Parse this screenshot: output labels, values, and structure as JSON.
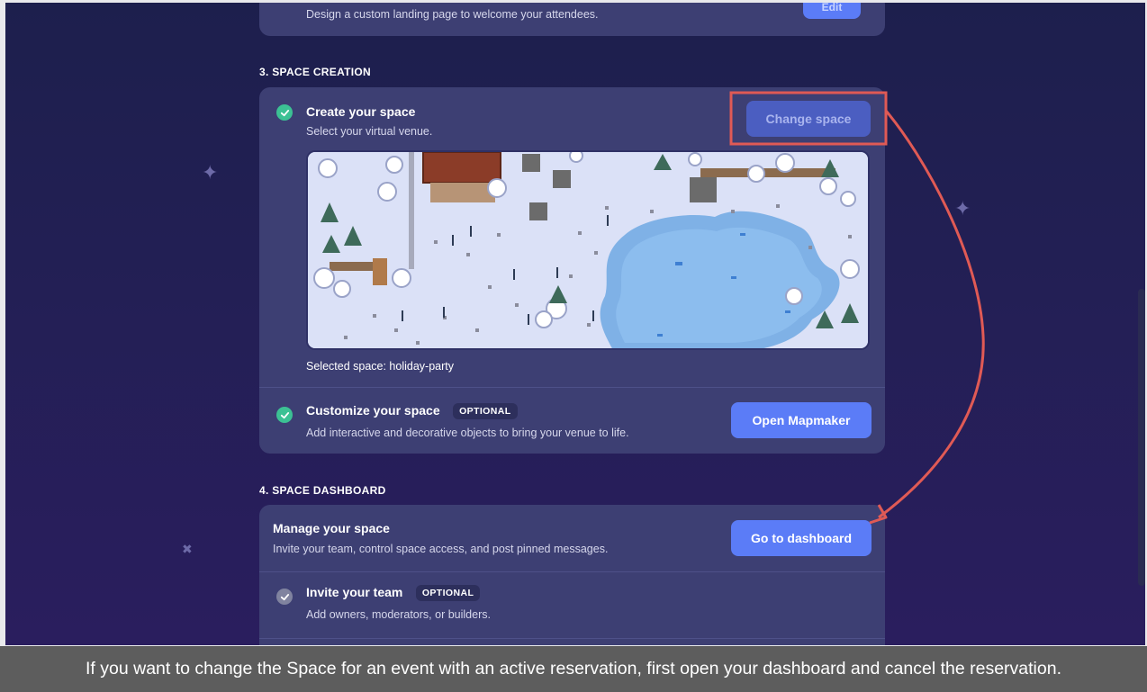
{
  "landing": {
    "description": "Design a custom landing page to welcome your attendees.",
    "button_label": "Edit"
  },
  "space_creation": {
    "heading": "3. SPACE CREATION",
    "create": {
      "title": "Create your space",
      "description": "Select your virtual venue.",
      "button_label": "Change space",
      "selected": "Selected space: holiday-party"
    },
    "customize": {
      "title": "Customize your space",
      "badge": "OPTIONAL",
      "description": "Add interactive and decorative objects to bring your venue to life.",
      "button_label": "Open Mapmaker"
    }
  },
  "space_dashboard": {
    "heading": "4. SPACE DASHBOARD",
    "manage": {
      "title": "Manage your space",
      "description": "Invite your team, control space access, and post pinned messages.",
      "button_label": "Go to dashboard"
    },
    "invite": {
      "title": "Invite your team",
      "badge": "OPTIONAL",
      "description": "Add owners, moderators, or builders."
    }
  },
  "caption": "If you want to change the Space for an event with an active reservation, first open your dashboard and cancel the reservation.",
  "colors": {
    "accent": "#5b7cf7",
    "success": "#3cc194",
    "highlight_box": "#e05a55"
  },
  "icons": [
    "check-icon",
    "sparkle-icon"
  ]
}
